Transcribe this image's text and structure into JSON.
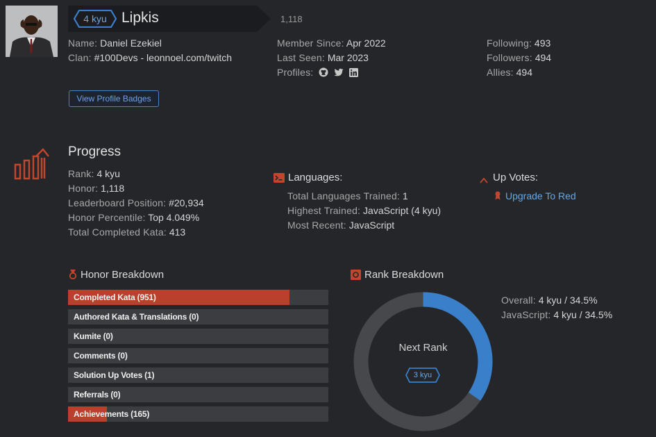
{
  "header": {
    "kyu_badge": "4 kyu",
    "username": "Lipkis",
    "honor_count": "1,118"
  },
  "profile": {
    "name_label": "Name:",
    "name_value": "Daniel Ezekiel",
    "clan_label": "Clan:",
    "clan_value": "#100Devs - leonnoel.com/twitch",
    "member_since_label": "Member Since:",
    "member_since_value": "Apr 2022",
    "last_seen_label": "Last Seen:",
    "last_seen_value": "Mar 2023",
    "profiles_label": "Profiles:",
    "profile_icons": [
      "github-icon",
      "twitter-icon",
      "linkedin-icon"
    ],
    "following_label": "Following:",
    "following_value": "493",
    "followers_label": "Followers:",
    "followers_value": "494",
    "allies_label": "Allies:",
    "allies_value": "494",
    "view_badges_button": "View Profile Badges"
  },
  "progress": {
    "title": "Progress",
    "rank_label": "Rank:",
    "rank_value": "4 kyu",
    "honor_label": "Honor:",
    "honor_value": "1,118",
    "leaderboard_label": "Leaderboard Position:",
    "leaderboard_value": "#20,934",
    "percentile_label": "Honor Percentile:",
    "percentile_value": "Top 4.049%",
    "completed_label": "Total Completed Kata:",
    "completed_value": "413"
  },
  "languages": {
    "title": "Languages:",
    "trained_label": "Total Languages Trained:",
    "trained_value": "1",
    "highest_label": "Highest Trained:",
    "highest_value": "JavaScript (4 kyu)",
    "recent_label": "Most Recent:",
    "recent_value": "JavaScript"
  },
  "upvotes": {
    "title": "Up Votes:",
    "upgrade_link": "Upgrade To Red"
  },
  "honor_breakdown": {
    "title": "Honor Breakdown",
    "items": [
      {
        "label": "Completed Kata (951)",
        "fill": 0.85
      },
      {
        "label": "Authored Kata & Translations (0)",
        "fill": 0
      },
      {
        "label": "Kumite (0)",
        "fill": 0
      },
      {
        "label": "Comments (0)",
        "fill": 0
      },
      {
        "label": "Solution Up Votes (1)",
        "fill": 0
      },
      {
        "label": "Referrals (0)",
        "fill": 0
      },
      {
        "label": "Achievements (165)",
        "fill": 0.15
      }
    ]
  },
  "rank_breakdown": {
    "title": "Rank Breakdown",
    "center_label": "Next Rank",
    "next_rank_badge": "3 kyu",
    "progress_fraction": 0.345,
    "overall_label": "Overall:",
    "overall_value": "4 kyu / 34.5%",
    "js_label": "JavaScript:",
    "js_value": "4 kyu / 34.5%"
  },
  "colors": {
    "accent_blue": "#3a7fc9",
    "accent_red": "#b8402c",
    "background": "#25262a"
  }
}
